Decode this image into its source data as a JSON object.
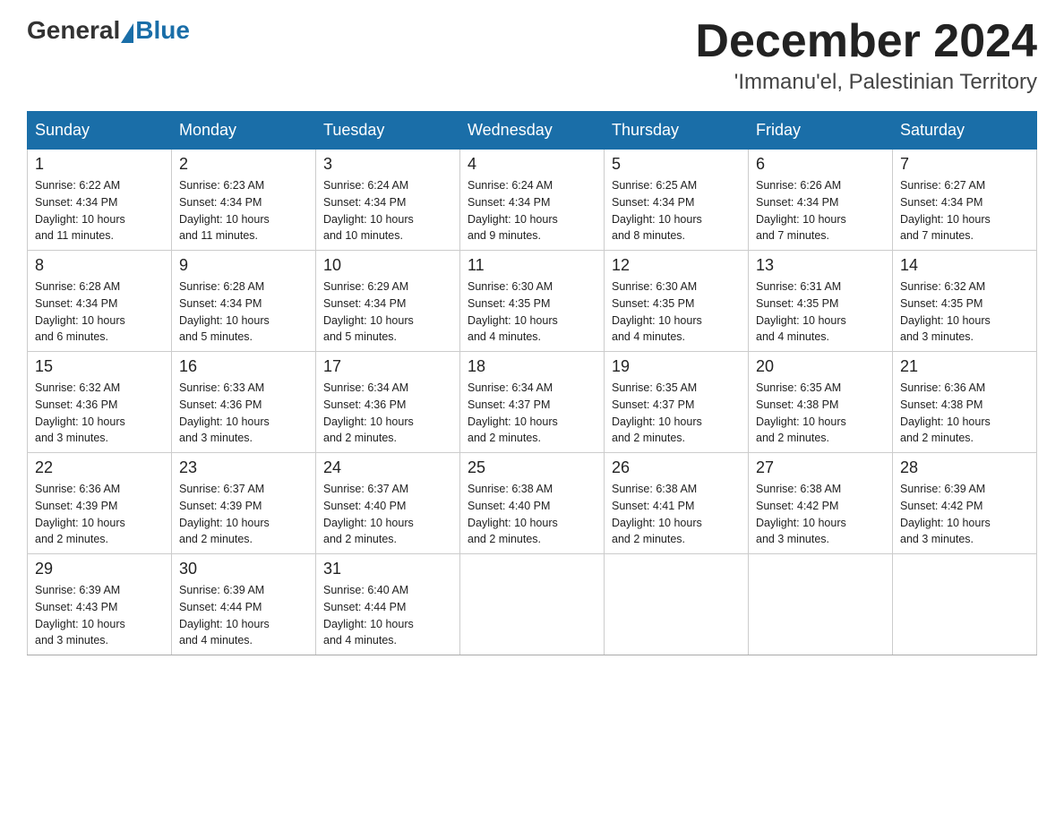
{
  "header": {
    "logo_general": "General",
    "logo_blue": "Blue",
    "month_title": "December 2024",
    "location": "'Immanu'el, Palestinian Territory"
  },
  "days_of_week": [
    "Sunday",
    "Monday",
    "Tuesday",
    "Wednesday",
    "Thursday",
    "Friday",
    "Saturday"
  ],
  "weeks": [
    [
      {
        "day": "1",
        "sunrise": "6:22 AM",
        "sunset": "4:34 PM",
        "daylight": "10 hours and 11 minutes."
      },
      {
        "day": "2",
        "sunrise": "6:23 AM",
        "sunset": "4:34 PM",
        "daylight": "10 hours and 11 minutes."
      },
      {
        "day": "3",
        "sunrise": "6:24 AM",
        "sunset": "4:34 PM",
        "daylight": "10 hours and 10 minutes."
      },
      {
        "day": "4",
        "sunrise": "6:24 AM",
        "sunset": "4:34 PM",
        "daylight": "10 hours and 9 minutes."
      },
      {
        "day": "5",
        "sunrise": "6:25 AM",
        "sunset": "4:34 PM",
        "daylight": "10 hours and 8 minutes."
      },
      {
        "day": "6",
        "sunrise": "6:26 AM",
        "sunset": "4:34 PM",
        "daylight": "10 hours and 7 minutes."
      },
      {
        "day": "7",
        "sunrise": "6:27 AM",
        "sunset": "4:34 PM",
        "daylight": "10 hours and 7 minutes."
      }
    ],
    [
      {
        "day": "8",
        "sunrise": "6:28 AM",
        "sunset": "4:34 PM",
        "daylight": "10 hours and 6 minutes."
      },
      {
        "day": "9",
        "sunrise": "6:28 AM",
        "sunset": "4:34 PM",
        "daylight": "10 hours and 5 minutes."
      },
      {
        "day": "10",
        "sunrise": "6:29 AM",
        "sunset": "4:34 PM",
        "daylight": "10 hours and 5 minutes."
      },
      {
        "day": "11",
        "sunrise": "6:30 AM",
        "sunset": "4:35 PM",
        "daylight": "10 hours and 4 minutes."
      },
      {
        "day": "12",
        "sunrise": "6:30 AM",
        "sunset": "4:35 PM",
        "daylight": "10 hours and 4 minutes."
      },
      {
        "day": "13",
        "sunrise": "6:31 AM",
        "sunset": "4:35 PM",
        "daylight": "10 hours and 4 minutes."
      },
      {
        "day": "14",
        "sunrise": "6:32 AM",
        "sunset": "4:35 PM",
        "daylight": "10 hours and 3 minutes."
      }
    ],
    [
      {
        "day": "15",
        "sunrise": "6:32 AM",
        "sunset": "4:36 PM",
        "daylight": "10 hours and 3 minutes."
      },
      {
        "day": "16",
        "sunrise": "6:33 AM",
        "sunset": "4:36 PM",
        "daylight": "10 hours and 3 minutes."
      },
      {
        "day": "17",
        "sunrise": "6:34 AM",
        "sunset": "4:36 PM",
        "daylight": "10 hours and 2 minutes."
      },
      {
        "day": "18",
        "sunrise": "6:34 AM",
        "sunset": "4:37 PM",
        "daylight": "10 hours and 2 minutes."
      },
      {
        "day": "19",
        "sunrise": "6:35 AM",
        "sunset": "4:37 PM",
        "daylight": "10 hours and 2 minutes."
      },
      {
        "day": "20",
        "sunrise": "6:35 AM",
        "sunset": "4:38 PM",
        "daylight": "10 hours and 2 minutes."
      },
      {
        "day": "21",
        "sunrise": "6:36 AM",
        "sunset": "4:38 PM",
        "daylight": "10 hours and 2 minutes."
      }
    ],
    [
      {
        "day": "22",
        "sunrise": "6:36 AM",
        "sunset": "4:39 PM",
        "daylight": "10 hours and 2 minutes."
      },
      {
        "day": "23",
        "sunrise": "6:37 AM",
        "sunset": "4:39 PM",
        "daylight": "10 hours and 2 minutes."
      },
      {
        "day": "24",
        "sunrise": "6:37 AM",
        "sunset": "4:40 PM",
        "daylight": "10 hours and 2 minutes."
      },
      {
        "day": "25",
        "sunrise": "6:38 AM",
        "sunset": "4:40 PM",
        "daylight": "10 hours and 2 minutes."
      },
      {
        "day": "26",
        "sunrise": "6:38 AM",
        "sunset": "4:41 PM",
        "daylight": "10 hours and 2 minutes."
      },
      {
        "day": "27",
        "sunrise": "6:38 AM",
        "sunset": "4:42 PM",
        "daylight": "10 hours and 3 minutes."
      },
      {
        "day": "28",
        "sunrise": "6:39 AM",
        "sunset": "4:42 PM",
        "daylight": "10 hours and 3 minutes."
      }
    ],
    [
      {
        "day": "29",
        "sunrise": "6:39 AM",
        "sunset": "4:43 PM",
        "daylight": "10 hours and 3 minutes."
      },
      {
        "day": "30",
        "sunrise": "6:39 AM",
        "sunset": "4:44 PM",
        "daylight": "10 hours and 4 minutes."
      },
      {
        "day": "31",
        "sunrise": "6:40 AM",
        "sunset": "4:44 PM",
        "daylight": "10 hours and 4 minutes."
      },
      null,
      null,
      null,
      null
    ]
  ]
}
